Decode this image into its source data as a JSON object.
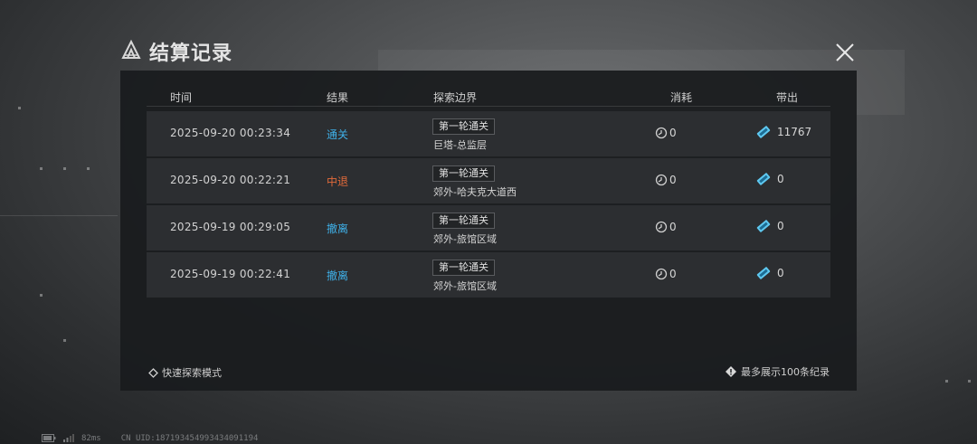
{
  "window": {
    "title": "结算记录"
  },
  "table": {
    "headers": {
      "time": "时间",
      "result": "结果",
      "frontier": "探索边界",
      "consume": "消耗",
      "bring": "带出"
    },
    "rows": [
      {
        "time": "2025-09-20 00:23:34",
        "result": "通关",
        "result_color": "#3fb0e8",
        "tag": "第一轮通关",
        "area": "巨塔-总监层",
        "consume": "0",
        "bring": "11767"
      },
      {
        "time": "2025-09-20 00:22:21",
        "result": "中退",
        "result_color": "#e06a3a",
        "tag": "第一轮通关",
        "area": "郊外-哈夫克大道西",
        "consume": "0",
        "bring": "0"
      },
      {
        "time": "2025-09-19 00:29:05",
        "result": "撤离",
        "result_color": "#3fb0e8",
        "tag": "第一轮通关",
        "area": "郊外-旅馆区域",
        "consume": "0",
        "bring": "0"
      },
      {
        "time": "2025-09-19 00:22:41",
        "result": "撤离",
        "result_color": "#3fb0e8",
        "tag": "第一轮通关",
        "area": "郊外-旅馆区域",
        "consume": "0",
        "bring": "0"
      }
    ]
  },
  "footer": {
    "quick_mode": "快速探索模式",
    "limit_note": "最多展示100条纪录"
  },
  "statusbar": {
    "ping": "82ms",
    "uid": "CN UID:187193454993434091194"
  },
  "icons": {
    "logo": "triangle-logo-icon",
    "close": "close-icon",
    "consume": "clock-icon",
    "bring": "ticket-icon",
    "quick": "diamond-icon",
    "info": "info-diamond-icon"
  },
  "colors": {
    "accent_blue": "#3fb0e8",
    "accent_orange": "#e06a3a",
    "ticket": "#5ec8f0"
  }
}
